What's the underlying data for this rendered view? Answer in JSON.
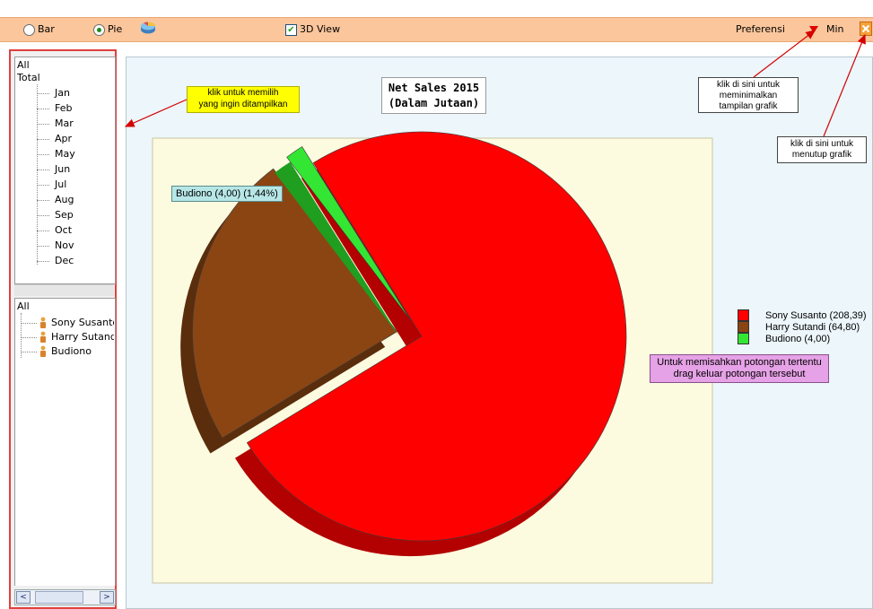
{
  "toolbar": {
    "bar_label": "Bar",
    "pie_label": "Pie",
    "view3d_label": "3D View",
    "preferensi_label": "Preferensi",
    "min_label": "Min",
    "chart_type_selected": "Pie",
    "view3d_checked": true
  },
  "period_tree": {
    "root": "All",
    "group": "Total",
    "months": [
      "Jan",
      "Feb",
      "Mar",
      "Apr",
      "May",
      "Jun",
      "Jul",
      "Aug",
      "Sep",
      "Oct",
      "Nov",
      "Dec"
    ]
  },
  "sales_tree": {
    "root": "All",
    "people": [
      "Sony Susanto",
      "Harry Sutandi",
      "Budiono"
    ]
  },
  "annotations": {
    "select_hint": "klik untuk memilih\nyang ingin ditampilkan",
    "minimize_hint": "klik di sini untuk\nmeminimalkan\ntampilan grafik",
    "close_hint": "klik di sini untuk\nmenutup grafik",
    "drag_hint": "Untuk memisahkan potongan tertentu\ndrag keluar potongan tersebut"
  },
  "chart_data": {
    "type": "pie",
    "title": "Net Sales  2015\n(Dalam Jutaan)",
    "three_d": true,
    "legend_position": "right",
    "data_label": "Budiono (4,00) (1,44%)",
    "slices": [
      {
        "name": "Sony Susanto",
        "value": 208.39,
        "legend": "Sony Susanto (208,39)",
        "color": "#ff0000",
        "side_color": "#b30000"
      },
      {
        "name": "Harry Sutandi",
        "value": 64.8,
        "legend": "Harry Sutandi (64,80)",
        "color": "#8b4513",
        "side_color": "#5a2d0c"
      },
      {
        "name": "Budiono",
        "value": 4.0,
        "legend": "Budiono (4,00)",
        "color": "#33e633",
        "side_color": "#1f9e1f"
      }
    ]
  }
}
